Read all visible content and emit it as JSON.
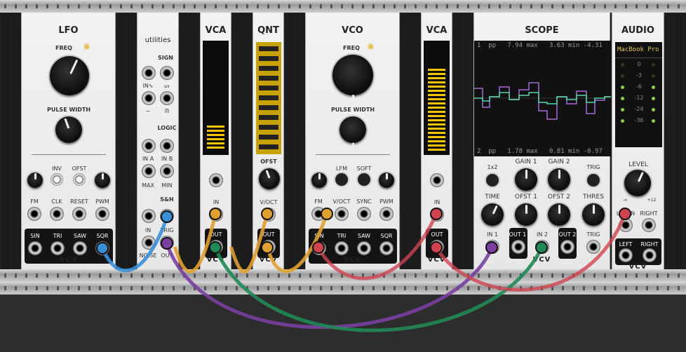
{
  "brand": "VCV",
  "lfo": {
    "title": "LFO",
    "freq": "FREQ",
    "pulse_width": "PULSE WIDTH",
    "inv": "INV",
    "ofst": "OFST",
    "fm": "FM",
    "clk": "CLK",
    "reset": "RESET",
    "pwm": "PWM",
    "sin": "SIN",
    "tri": "TRI",
    "saw": "SAW",
    "sqr": "SQR"
  },
  "utils": {
    "title": "utilities",
    "sign": "SIGN",
    "in_tilde": "IN∿",
    "s": "ᔕ",
    "tilde": "∼",
    "m": "ᗰ",
    "logic": "LOGIC",
    "in_a": "IN A",
    "in_b": "IN B",
    "max": "MAX",
    "min": "MIN",
    "sh": "S&H",
    "in": "IN",
    "trig": "TRIG",
    "noise": "NOISE",
    "out": "OUT"
  },
  "vca1": {
    "title": "VCA",
    "in": "IN",
    "out": "OUT"
  },
  "qnt": {
    "title": "QNT",
    "ofst": "OFST",
    "voct": "V/OCT",
    "out": "OUT"
  },
  "vco": {
    "title": "VCO",
    "freq": "FREQ",
    "pulse_width": "PULSE WIDTH",
    "lfm": "LFM",
    "soft": "SOFT",
    "fm": "FM",
    "voct": "V/OCT",
    "sync": "SYNC",
    "pwm": "PWM",
    "sin": "SIN",
    "tri": "TRI",
    "saw": "SAW",
    "sqr": "SQR"
  },
  "vca2": {
    "title": "VCA",
    "in": "IN",
    "out": "OUT",
    "level": 0.9
  },
  "scope": {
    "title": "SCOPE",
    "readout1": "1  pp   7.94 max   3.63 min -4.31",
    "readout2": "2  pp   1.78 max   0.81 min -0.97",
    "x2": "1x2",
    "gain1": "GAIN 1",
    "gain2": "GAIN 2",
    "trig_btn": "TRIG",
    "time": "TIME",
    "ofst1": "OFST 1",
    "ofst2": "OFST 2",
    "thres": "THRES",
    "in1": "IN 1",
    "out1": "OUT 1",
    "in2": "IN 2",
    "out2": "OUT 2",
    "trig": "TRIG"
  },
  "audio": {
    "title": "AUDIO",
    "device": "MacBook Pro",
    "db_labels": [
      "0",
      "-3",
      "-6",
      "-12",
      "-24",
      "-36"
    ],
    "level": "LEVEL",
    "min": "-∞",
    "max": "+12",
    "lmon": "L/MON",
    "right_in": "RIGHT",
    "left": "LEFT",
    "right": "RIGHT"
  },
  "colors": {
    "yellow": "#f5c400",
    "blue": "#3a8fd8",
    "purple": "#7a3fa0",
    "green": "#1f8a55",
    "orange": "#e0a030",
    "red": "#d04450"
  }
}
